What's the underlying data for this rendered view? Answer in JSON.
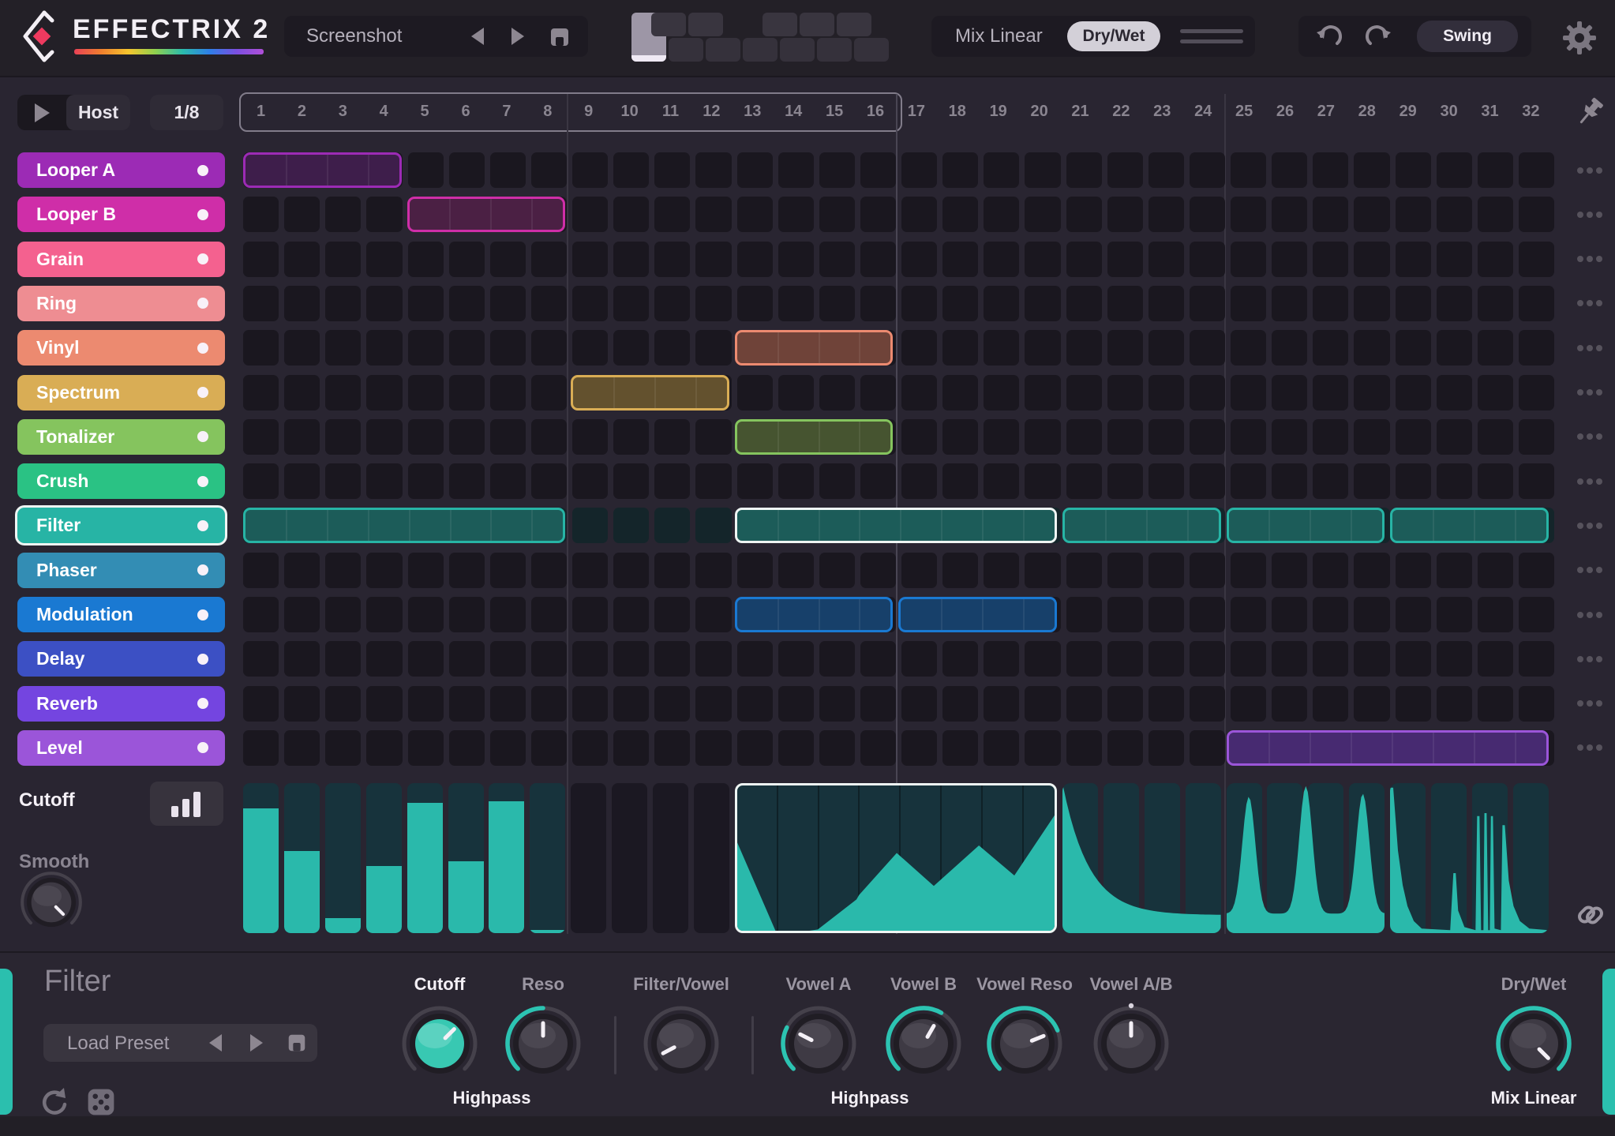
{
  "app": {
    "title": "EFFECTRIX 2"
  },
  "colors": {
    "teal": "#2bbcad",
    "editor_fill": "#2ab9ab",
    "editor_bg": "#17333c",
    "selected_border": "#eef5f3",
    "background": "#292531"
  },
  "topbar": {
    "preset_name": "Screenshot",
    "mix_mode_label": "Mix Linear",
    "drywet_label": "Dry/Wet",
    "swing_label": "Swing",
    "pattern_keys": 12,
    "selected_pattern": 1
  },
  "transport": {
    "host_label": "Host",
    "rate_label": "1/8"
  },
  "sequencer": {
    "steps": 32,
    "loop_start": 1,
    "loop_end": 16,
    "step_numbers": [
      "1",
      "2",
      "3",
      "4",
      "5",
      "6",
      "7",
      "8",
      "9",
      "10",
      "11",
      "12",
      "13",
      "14",
      "15",
      "16",
      "17",
      "18",
      "19",
      "20",
      "21",
      "22",
      "23",
      "24",
      "25",
      "26",
      "27",
      "28",
      "29",
      "30",
      "31",
      "32"
    ],
    "tracks": [
      {
        "label": "Looper A",
        "color": "#9c2bb5",
        "fill": "#3e1e4b",
        "selected": false,
        "blocks": [
          {
            "start": 1,
            "end": 4
          }
        ]
      },
      {
        "label": "Looper B",
        "color": "#cf2ea8",
        "fill": "#4b2044",
        "selected": false,
        "blocks": [
          {
            "start": 5,
            "end": 8
          }
        ]
      },
      {
        "label": "Grain",
        "color": "#f4618f",
        "fill": "#4b2038",
        "selected": false,
        "blocks": []
      },
      {
        "label": "Ring",
        "color": "#ee8d92",
        "fill": "#4b2a2e",
        "selected": false,
        "blocks": []
      },
      {
        "label": "Vinyl",
        "color": "#ec8a70",
        "fill": "#6f4339",
        "selected": false,
        "blocks": [
          {
            "start": 13,
            "end": 16
          }
        ]
      },
      {
        "label": "Spectrum",
        "color": "#d9ad55",
        "fill": "#63512e",
        "selected": false,
        "blocks": [
          {
            "start": 9,
            "end": 12
          }
        ]
      },
      {
        "label": "Tonalizer",
        "color": "#85c45e",
        "fill": "#465430",
        "selected": false,
        "blocks": [
          {
            "start": 13,
            "end": 16
          }
        ]
      },
      {
        "label": "Crush",
        "color": "#2ac284",
        "fill": "#1c5643",
        "selected": false,
        "blocks": []
      },
      {
        "label": "Filter",
        "color": "#27b4a5",
        "fill": "#1c5c59",
        "selected": true,
        "blocks": [
          {
            "start": 1,
            "end": 8
          },
          {
            "start": 13,
            "end": 20,
            "selected": true
          },
          {
            "start": 21,
            "end": 24
          },
          {
            "start": 25,
            "end": 28
          },
          {
            "start": 29,
            "end": 32
          }
        ]
      },
      {
        "label": "Phaser",
        "color": "#338db4",
        "fill": "#1c3f52",
        "selected": false,
        "blocks": []
      },
      {
        "label": "Modulation",
        "color": "#1a79d2",
        "fill": "#17406a",
        "selected": false,
        "blocks": [
          {
            "start": 13,
            "end": 16
          },
          {
            "start": 17,
            "end": 20
          }
        ]
      },
      {
        "label": "Delay",
        "color": "#3c50c4",
        "fill": "#222a5e",
        "selected": false,
        "blocks": []
      },
      {
        "label": "Reverb",
        "color": "#7445e0",
        "fill": "#34246a",
        "selected": false,
        "blocks": []
      },
      {
        "label": "Level",
        "color": "#9b55d9",
        "fill": "#472a71",
        "selected": false,
        "blocks": [
          {
            "start": 25,
            "end": 32
          }
        ]
      }
    ]
  },
  "editor": {
    "parameter_label": "Cutoff",
    "smooth_label": "Smooth",
    "bar_steps": {
      "start": 1,
      "end": 8,
      "values": [
        0.83,
        0.55,
        0.1,
        0.45,
        0.87,
        0.48,
        0.88,
        0.02
      ]
    },
    "empty_steps": {
      "start": 9,
      "end": 12
    },
    "selected_region": {
      "start": 13,
      "end": 20,
      "curve_points": [
        [
          0,
          0.62
        ],
        [
          0.125,
          0.0
        ],
        [
          0.25,
          0.04
        ],
        [
          0.37,
          0.24
        ],
        [
          0.378,
          0.27
        ],
        [
          0.495,
          0.55
        ],
        [
          0.61,
          0.33
        ],
        [
          0.75,
          0.6
        ],
        [
          0.86,
          0.4
        ],
        [
          1.0,
          0.85
        ]
      ]
    },
    "decay_region": {
      "start": 21,
      "end": 24,
      "formula": "0.12 + 0.88*exp(-6x)"
    },
    "bumps_region": {
      "start": 25,
      "end": 28,
      "baseline": 0.13,
      "bumps": [
        {
          "center": 0.14,
          "height": 0.78
        },
        {
          "center": 0.5,
          "height": 0.85
        },
        {
          "center": 0.86,
          "height": 0.8
        }
      ],
      "width": 0.058
    },
    "spikes_region": {
      "start": 29,
      "end": 32,
      "points": [
        [
          0,
          0.97
        ],
        [
          0.02,
          0.97
        ],
        [
          0.05,
          0.55
        ],
        [
          0.08,
          0.32
        ],
        [
          0.11,
          0.18
        ],
        [
          0.15,
          0.08
        ],
        [
          0.2,
          0.03
        ],
        [
          0.38,
          0.02
        ],
        [
          0.4,
          0.4
        ],
        [
          0.415,
          0.4
        ],
        [
          0.43,
          0.15
        ],
        [
          0.47,
          0.04
        ],
        [
          0.54,
          0.02
        ],
        [
          0.55,
          0.78
        ],
        [
          0.565,
          0.78
        ],
        [
          0.575,
          0.02
        ],
        [
          0.59,
          0.02
        ],
        [
          0.596,
          0.8
        ],
        [
          0.61,
          0.8
        ],
        [
          0.62,
          0.02
        ],
        [
          0.63,
          0.02
        ],
        [
          0.637,
          0.78
        ],
        [
          0.65,
          0.78
        ],
        [
          0.66,
          0.03
        ],
        [
          0.7,
          0.02
        ],
        [
          0.71,
          0.72
        ],
        [
          0.725,
          0.72
        ],
        [
          0.75,
          0.35
        ],
        [
          0.78,
          0.18
        ],
        [
          0.82,
          0.08
        ],
        [
          0.88,
          0.03
        ],
        [
          1,
          0.02
        ]
      ]
    }
  },
  "panel": {
    "title": "Filter",
    "preset_placeholder": "Load Preset",
    "knobs": [
      {
        "label": "Cutoff",
        "face": "teal",
        "arc": false,
        "pointer_deg": 45,
        "label_white": true
      },
      {
        "label": "Reso",
        "face": "dark",
        "arc": true,
        "pointer_deg": 0,
        "label_white": false
      },
      {
        "label": "Filter/Vowel",
        "face": "dark",
        "arc": false,
        "pointer_deg": -118,
        "label_white": false
      },
      {
        "label": "Vowel A",
        "face": "dark",
        "arc": true,
        "pointer_deg": -63,
        "label_white": false
      },
      {
        "label": "Vowel B",
        "face": "dark",
        "arc": true,
        "pointer_deg": 30,
        "label_white": false
      },
      {
        "label": "Vowel Reso",
        "face": "dark",
        "arc": true,
        "pointer_deg": 68,
        "label_white": false
      },
      {
        "label": "Vowel A/B",
        "face": "dark",
        "arc": false,
        "pointer_deg": 0,
        "label_white": false,
        "top_dot": true
      },
      {
        "label": "Dry/Wet",
        "face": "dark",
        "arc": true,
        "pointer_deg": 135,
        "label_white": false
      }
    ],
    "group_labels": [
      "Highpass",
      "Highpass",
      "Mix Linear"
    ],
    "smooth_knob": {
      "pointer_deg": 135
    }
  }
}
